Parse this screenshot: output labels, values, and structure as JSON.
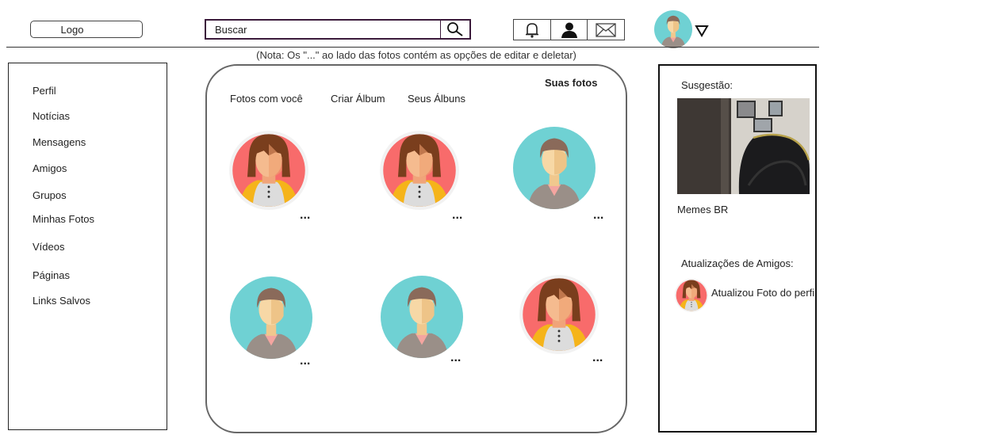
{
  "header": {
    "logo": "Logo",
    "search": {
      "placeholder": "Buscar",
      "value": ""
    },
    "icons": [
      "search-icon",
      "bell-icon",
      "user-icon",
      "mail-icon",
      "avatar",
      "dropdown-triangle-icon"
    ]
  },
  "note": "(Nota: Os \"...\" ao lado das fotos contém as opções de editar e deletar)",
  "sidebar": {
    "items": [
      {
        "label": "Perfil"
      },
      {
        "label": "Notícias"
      },
      {
        "label": "Mensagens"
      },
      {
        "label": "Amigos"
      },
      {
        "label": "Grupos"
      },
      {
        "label": "Minhas Fotos"
      },
      {
        "label": "Vídeos"
      },
      {
        "label": "Páginas"
      },
      {
        "label": "Links Salvos"
      }
    ]
  },
  "gallery": {
    "title": "Suas fotos",
    "tabs": [
      {
        "label": "Fotos com você"
      },
      {
        "label": "Criar Álbum"
      },
      {
        "label": "Seus Álbuns"
      }
    ],
    "more_label": "...",
    "photos": [
      {
        "avatar": "girl-red",
        "more": "..."
      },
      {
        "avatar": "girl-red",
        "more": "..."
      },
      {
        "avatar": "boy-teal",
        "more": "..."
      },
      {
        "avatar": "boy-teal",
        "more": "..."
      },
      {
        "avatar": "boy-teal",
        "more": "..."
      },
      {
        "avatar": "girl-red",
        "more": "..."
      }
    ]
  },
  "right": {
    "suggestion_title": "Susgestão:",
    "suggestion_name": "Memes BR",
    "updates_title": "Atualizações de Amigos:",
    "update_text": "Atualizou Foto do perfil"
  },
  "colors": {
    "accent_border": "#3b1a3b",
    "girl_bg": "#f86b6b",
    "boy_bg": "#6fd1d3",
    "hair": "#7a3e1d",
    "skin": "#f5bb8f"
  }
}
